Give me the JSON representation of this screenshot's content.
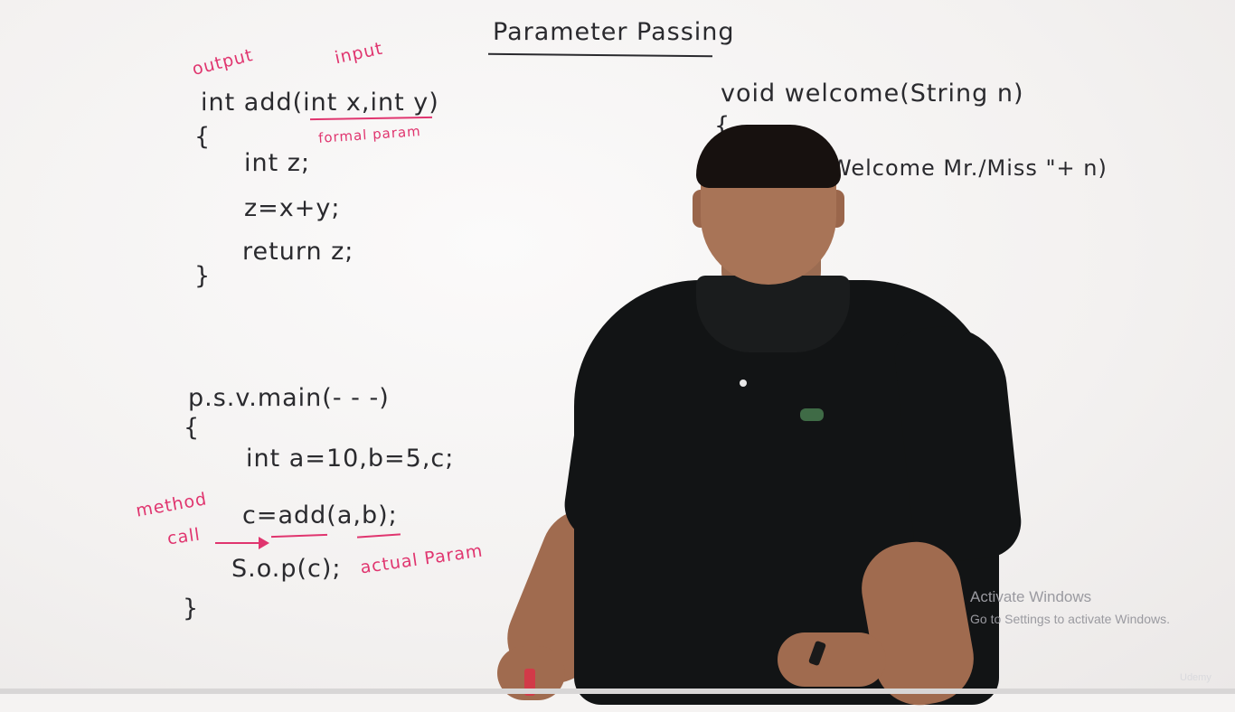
{
  "board": {
    "title": "Parameter Passing",
    "left_code": {
      "label_output": "output",
      "label_input": "input",
      "signature": "int add(int x,int y)",
      "open_brace": "{",
      "label_formal": "formal param",
      "line1": "int z;",
      "line2": "z=x+y;",
      "line3": "return z;",
      "close_brace": "}"
    },
    "main_code": {
      "signature": "p.s.v.main(- - -)",
      "open_brace": "{",
      "line1": "int a=10,b=5,c;",
      "label_method": "method",
      "label_call": "call",
      "line2": "c=add(a,b);",
      "line3": "S.o.p(c);",
      "label_actual": "actual Param",
      "close_brace": "}"
    },
    "right_code": {
      "signature": "void welcome(String n)",
      "open_brace": "{",
      "line1": "Welcome Mr./Miss \"+ n)"
    }
  },
  "watermark": {
    "title": "Activate Windows",
    "subtitle": "Go to Settings to activate Windows."
  },
  "brand": "Udemy",
  "colors": {
    "ink": "#2a2a2e",
    "pink_ink": "#e0356f",
    "shirt": "#121415",
    "board": "#f5f3f2"
  }
}
